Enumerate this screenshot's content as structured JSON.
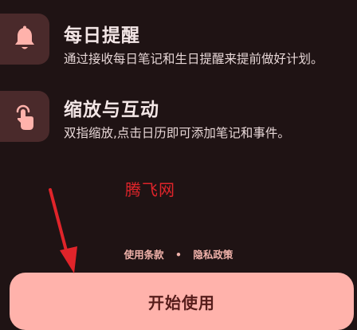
{
  "features": [
    {
      "icon": "bell-icon",
      "title": "每日提醒",
      "description": "通过接收每日笔记和生日提醒来提前做好计划。"
    },
    {
      "icon": "tap-gesture-icon",
      "title": "缩放与互动",
      "description": "双指缩放,点击日历即可添加笔记和事件。"
    }
  ],
  "watermark": "腾飞网",
  "footer_links": {
    "terms": "使用条款",
    "separator": "•",
    "privacy": "隐私政策"
  },
  "start_button": {
    "label": "开始使用"
  },
  "colors": {
    "background": "#1f1314",
    "icon_tile": "#4a2a2b",
    "icon_glyph": "#ffb2ab",
    "button": "#ffb2ab",
    "button_text": "#561d1b",
    "link_text": "#f0b2aa",
    "annotation_arrow": "#e0242a"
  }
}
